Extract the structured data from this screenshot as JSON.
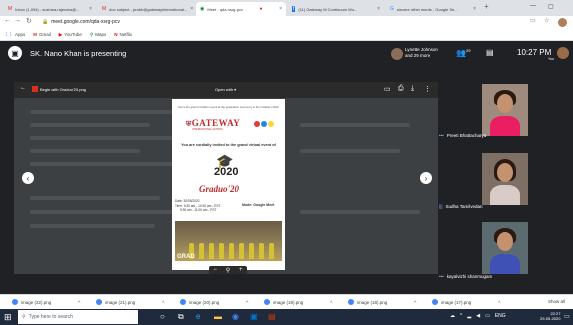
{
  "browser": {
    "tabs": [
      {
        "icon": "M",
        "label": "Inbox (1,094) - sushma.rajendra@..."
      },
      {
        "icon": "M",
        "label": "doc subject - prabh@gatewayinternational..."
      },
      {
        "icon": "◉",
        "label": "Meet - qda-xsrg-pcv"
      },
      {
        "icon": "f",
        "label": "(11) Gateway M Continuum Wo..."
      },
      {
        "icon": "G",
        "label": "sincere other words - Google Se..."
      }
    ],
    "new_tab": "+",
    "url": "meet.google.com/qda-xsrg-pcv",
    "bookmarks": [
      "Apps",
      "Gmail",
      "YouTube",
      "Maps",
      "Netflix"
    ]
  },
  "meet": {
    "presenting_text": "SK. Nano Khan is presenting",
    "participants_line1": "Lynette Johnson",
    "participants_line2": "and 29 more",
    "participant_count": "29",
    "time": "10:27 PM",
    "me_label": "You"
  },
  "doc_viewer": {
    "file_name": "Begin with Graduo'20.png",
    "open_with": "Open with",
    "zoom_out": "−",
    "zoom_in": "+"
  },
  "invite": {
    "top_line": "You're the grand invitation event at the graduation ceremony to the invitation 2020",
    "logo": "GATEWAY",
    "logo_sub": "INTERNATIONAL SCHOOL",
    "invited_text": "You are cordially invited to the grand virtual event of",
    "year": "2020",
    "title": "Graduo'20",
    "date": "Date: 30/05/2020",
    "time1": "Time: 9:30 am - 10:30 am - EST",
    "time2": "9:30 am - 11:00 am - PST",
    "mode": "Mode: Google Meet",
    "photo_caption": "GRAD"
  },
  "participants": [
    {
      "name": "Preeti Bhattacharya",
      "icon": "•••"
    },
    {
      "name": "Sudha Tamilvedan",
      "icon": "|||"
    },
    {
      "name": "kayalvizhi shanmugam",
      "icon": "•••"
    }
  ],
  "downloads": [
    "image (22).png",
    "image (21).png",
    "image (20).png",
    "image (19).png",
    "image (18).png",
    "image (17).png"
  ],
  "show_all": "Show all",
  "taskbar": {
    "search_placeholder": "Type here to search",
    "lang": "ENG",
    "time": "22:27",
    "date": "29-05-2020"
  }
}
